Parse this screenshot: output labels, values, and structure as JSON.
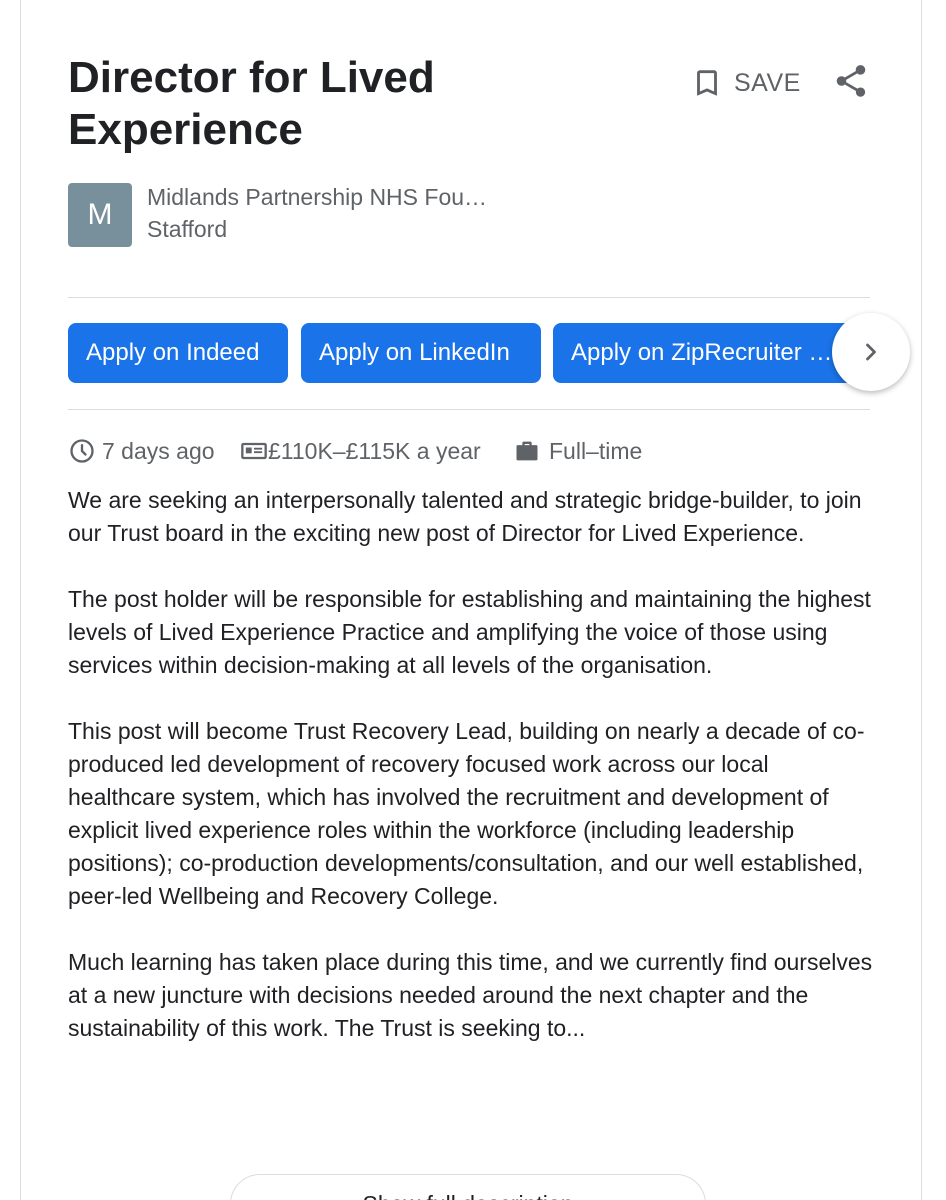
{
  "job": {
    "title": "Director for Lived Experience",
    "company": "Midlands Partnership NHS Fou…",
    "location": "Stafford",
    "logo_letter": "M",
    "logo_color": "#78909c"
  },
  "actions": {
    "save_label": "SAVE",
    "save_icon": "bookmark-icon",
    "share_icon": "share-icon"
  },
  "apply_options": [
    {
      "label": "Apply on Indeed"
    },
    {
      "label": "Apply on LinkedIn"
    },
    {
      "label": "Apply on ZipRecruiter …"
    }
  ],
  "meta": {
    "posted": "7 days ago",
    "salary": "£110K–£115K a year",
    "job_type": "Full–time"
  },
  "description": [
    "We are seeking an interpersonally talented and strategic bridge-builder, to join our Trust board in the exciting new post of Director for Lived Experience.",
    "The post holder will be responsible for establishing and maintaining the highest levels of Lived Experience Practice and amplifying the voice of those using services within decision-making at all levels of the organisation.",
    "This post will become Trust Recovery Lead, building on nearly a decade of co-produced led development of recovery focused work across our local healthcare system, which has involved the recruitment and development of explicit lived experience roles within the workforce (including leadership positions); co-production developments/consultation, and our well established, peer-led Wellbeing and Recovery College.",
    "Much learning has taken place during this time, and we currently find ourselves at a new juncture with decisions needed around the next chapter and the sustainability of this work. The Trust is seeking to..."
  ],
  "show_more_label": "Show full description",
  "colors": {
    "accent": "#1a73e8",
    "text": "#202124",
    "secondary_text": "#5f6368",
    "divider": "#dadce0"
  }
}
